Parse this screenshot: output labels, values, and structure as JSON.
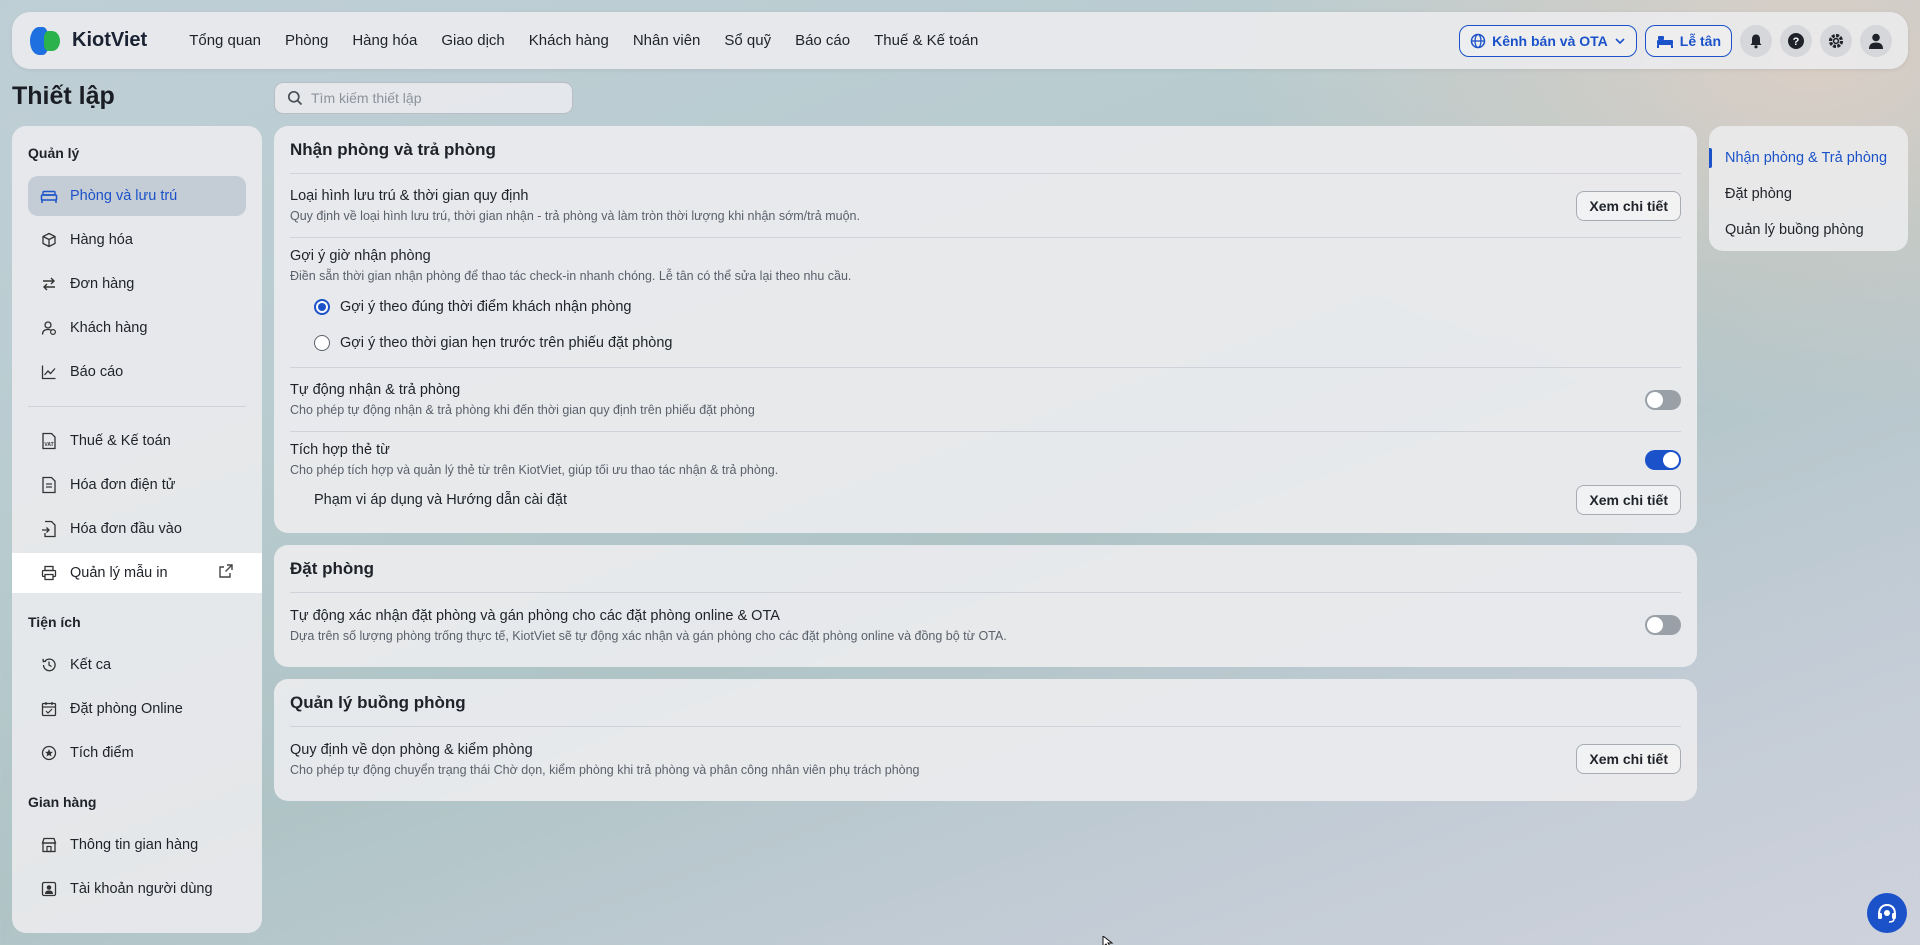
{
  "app": {
    "logo_text": "KiotViet"
  },
  "nav": {
    "items": [
      "Tổng quan",
      "Phòng",
      "Hàng hóa",
      "Giao dịch",
      "Khách hàng",
      "Nhân viên",
      "Sổ quỹ",
      "Báo cáo",
      "Thuế & Kế toán"
    ],
    "channel_button": "Kênh bán và OTA",
    "reception_button": "Lễ tân",
    "icons": [
      "bell-icon",
      "help-icon",
      "gear-icon",
      "user-icon"
    ]
  },
  "page": {
    "title": "Thiết lập"
  },
  "search": {
    "placeholder": "Tìm kiếm thiết lập",
    "value": ""
  },
  "sidebar": {
    "sections": {
      "manage": "Quản lý",
      "utilities": "Tiện ích",
      "store": "Gian hàng"
    },
    "manage_items": [
      {
        "label": "Phòng và lưu trú",
        "icon": "bed-icon",
        "active": true
      },
      {
        "label": "Hàng hóa",
        "icon": "box-icon"
      },
      {
        "label": "Đơn hàng",
        "icon": "swap-icon"
      },
      {
        "label": "Khách hàng",
        "icon": "customer-icon"
      },
      {
        "label": "Báo cáo",
        "icon": "chart-icon"
      }
    ],
    "other_items": [
      {
        "label": "Thuế & Kế toán",
        "icon": "vat-icon"
      },
      {
        "label": "Hóa đơn điện tử",
        "icon": "invoice-icon"
      },
      {
        "label": "Hóa đơn đầu vào",
        "icon": "input-invoice-icon"
      },
      {
        "label": "Quản lý mẫu in",
        "icon": "printer-icon",
        "external": true
      }
    ],
    "utility_items": [
      {
        "label": "Kết ca",
        "icon": "history-icon"
      },
      {
        "label": "Đặt phòng Online",
        "icon": "calendar-icon"
      },
      {
        "label": "Tích điểm",
        "icon": "star-icon"
      }
    ],
    "store_items": [
      {
        "label": "Thông tin gian hàng",
        "icon": "store-icon"
      },
      {
        "label": "Tài khoản người dùng",
        "icon": "account-icon"
      }
    ]
  },
  "checkin": {
    "title": "Nhận phòng và trả phòng",
    "stay_type": {
      "title": "Loại hình lưu trú & thời gian quy định",
      "desc": "Quy định về loại hình lưu trú, thời gian nhận - trả phòng và làm tròn thời lượng khi nhận sớm/trả muộn.",
      "button": "Xem chi tiết"
    },
    "suggest": {
      "title": "Gợi ý giờ nhận phòng",
      "desc": "Điền sẵn thời gian nhận phòng để thao tác check-in nhanh chóng. Lễ tân có thể sửa lại theo nhu cầu.",
      "option1": "Gợi ý theo đúng thời điểm khách nhận phòng",
      "option2": "Gợi ý theo thời gian hẹn trước trên phiếu đặt phòng",
      "selected": 1
    },
    "auto": {
      "title": "Tự động nhận & trả phòng",
      "desc": "Cho phép tự động nhận & trả phòng khi đến thời gian quy định trên phiếu đặt phòng",
      "enabled": false
    },
    "card_integration": {
      "title": "Tích hợp thẻ từ",
      "desc": "Cho phép tích hợp và quản lý thẻ từ trên KiotViet, giúp tối ưu thao tác nhận & trả phòng.",
      "enabled": true,
      "sub_label": "Phạm vi áp dụng và Hướng dẫn cài đặt",
      "button": "Xem chi tiết"
    }
  },
  "booking": {
    "title": "Đặt phòng",
    "auto_confirm": {
      "title": "Tự động xác nhận đặt phòng và gán phòng cho các đặt phòng online & OTA",
      "desc": "Dựa trên số lượng phòng trống thực tế, KiotViet sẽ tự động xác nhận và gán phòng cho các đặt phòng online và đồng bộ từ OTA.",
      "enabled": false
    }
  },
  "housekeeping": {
    "title": "Quản lý buồng phòng",
    "cleaning": {
      "title": "Quy định về dọn phòng & kiểm phòng",
      "desc": "Cho phép tự động chuyển trạng thái Chờ dọn, kiểm phòng khi trả phòng và phân công nhân viên phụ trách phòng",
      "button": "Xem chi tiết"
    }
  },
  "anchor": {
    "items": [
      "Nhận phòng & Trả phòng",
      "Đặt phòng",
      "Quản lý buồng phòng"
    ],
    "active": 0
  },
  "colors": {
    "accent": "#1b52c9",
    "card": "#ececee"
  }
}
